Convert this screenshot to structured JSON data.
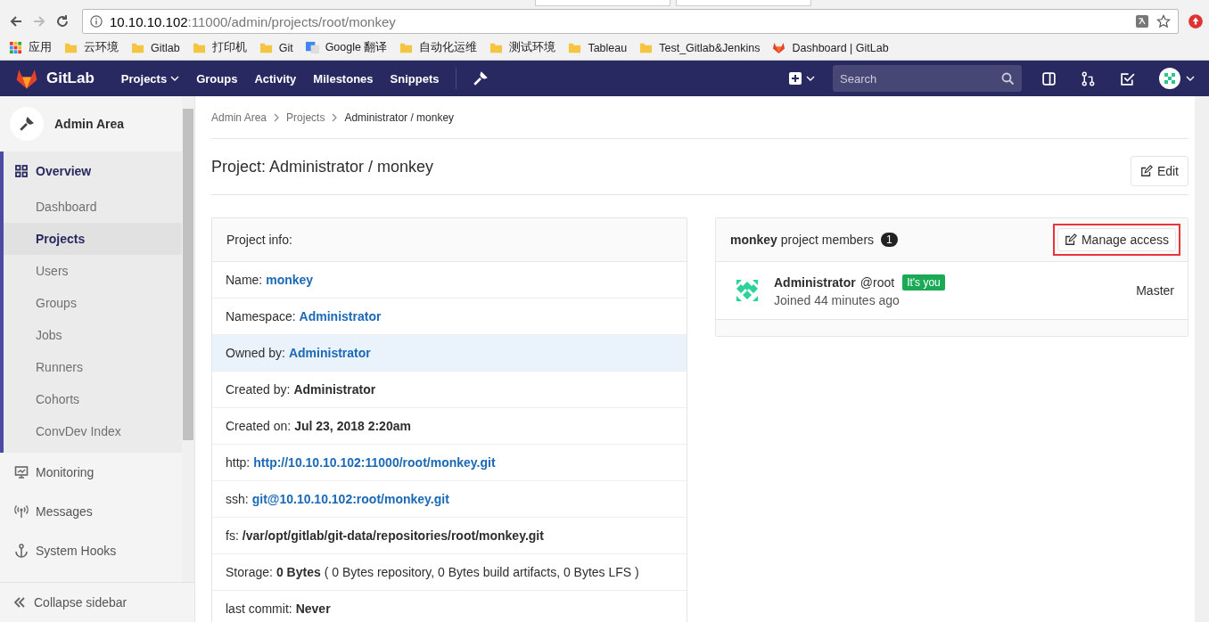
{
  "browser": {
    "url_host": "10.10.10.102",
    "url_path": ":11000/admin/projects/root/monkey",
    "bookmarks": [
      {
        "kind": "apps",
        "label": "应用"
      },
      {
        "kind": "folder",
        "label": "云环境"
      },
      {
        "kind": "folder",
        "label": "Gitlab"
      },
      {
        "kind": "folder",
        "label": "打印机"
      },
      {
        "kind": "folder",
        "label": "Git"
      },
      {
        "kind": "translate",
        "label": "Google 翻译"
      },
      {
        "kind": "folder",
        "label": "自动化运维"
      },
      {
        "kind": "folder",
        "label": "测试环境"
      },
      {
        "kind": "folder",
        "label": "Tableau"
      },
      {
        "kind": "folder",
        "label": "Test_Gitlab&Jenkins"
      },
      {
        "kind": "gitlab",
        "label": "Dashboard | GitLab"
      }
    ]
  },
  "navbar": {
    "brand": "GitLab",
    "links": [
      {
        "label": "Projects",
        "dropdown": true
      },
      {
        "label": "Groups",
        "dropdown": false
      },
      {
        "label": "Activity",
        "dropdown": false
      },
      {
        "label": "Milestones",
        "dropdown": false
      },
      {
        "label": "Snippets",
        "dropdown": false
      }
    ],
    "search": {
      "placeholder": "Search"
    }
  },
  "sidebar": {
    "title": "Admin Area",
    "items": [
      {
        "label": "Overview",
        "selected": true,
        "children": [
          {
            "label": "Dashboard",
            "selected": false
          },
          {
            "label": "Projects",
            "selected": true
          },
          {
            "label": "Users",
            "selected": false
          },
          {
            "label": "Groups",
            "selected": false
          },
          {
            "label": "Jobs",
            "selected": false
          },
          {
            "label": "Runners",
            "selected": false
          },
          {
            "label": "Cohorts",
            "selected": false
          },
          {
            "label": "ConvDev Index",
            "selected": false
          }
        ]
      },
      {
        "label": "Monitoring",
        "selected": false
      },
      {
        "label": "Messages",
        "selected": false
      },
      {
        "label": "System Hooks",
        "selected": false
      }
    ],
    "collapse_label": "Collapse sidebar"
  },
  "breadcrumbs": [
    "Admin Area",
    "Projects",
    "Administrator / monkey"
  ],
  "page_title": "Project: Administrator / monkey",
  "edit_button": "Edit",
  "info": {
    "heading": "Project info:",
    "rows": [
      {
        "label": "Name:",
        "value": "monkey",
        "kind": "link",
        "highlighted": false
      },
      {
        "label": "Namespace:",
        "value": "Administrator",
        "kind": "link",
        "highlighted": false
      },
      {
        "label": "Owned by:",
        "value": "Administrator",
        "kind": "link",
        "highlighted": true
      },
      {
        "label": "Created by:",
        "value": "Administrator",
        "kind": "bold",
        "highlighted": false
      },
      {
        "label": "Created on:",
        "value": "Jul 23, 2018 2:20am",
        "kind": "bold",
        "highlighted": false
      },
      {
        "label": "http:",
        "value": "http://10.10.10.102:11000/root/monkey.git",
        "kind": "link",
        "highlighted": false
      },
      {
        "label": "ssh:",
        "value": "git@10.10.10.102:root/monkey.git",
        "kind": "link",
        "highlighted": false
      },
      {
        "label": "fs:",
        "value": "/var/opt/gitlab/git-data/repositories/root/monkey.git",
        "kind": "bold",
        "highlighted": false
      },
      {
        "label": "Storage:",
        "value": "0 Bytes",
        "kind": "bold",
        "suffix": "( 0 Bytes repository, 0 Bytes build artifacts, 0 Bytes LFS )",
        "highlighted": false
      },
      {
        "label": "last commit:",
        "value": "Never",
        "kind": "bold",
        "highlighted": false
      }
    ]
  },
  "members": {
    "project": "monkey",
    "heading": "project members",
    "count": "1",
    "manage_button": {
      "label": "Manage access",
      "annotated": true
    },
    "list": [
      {
        "name": "Administrator",
        "username": "@root",
        "badge": "It's you",
        "joined": "Joined 44 minutes ago",
        "role": "Master"
      }
    ]
  }
}
